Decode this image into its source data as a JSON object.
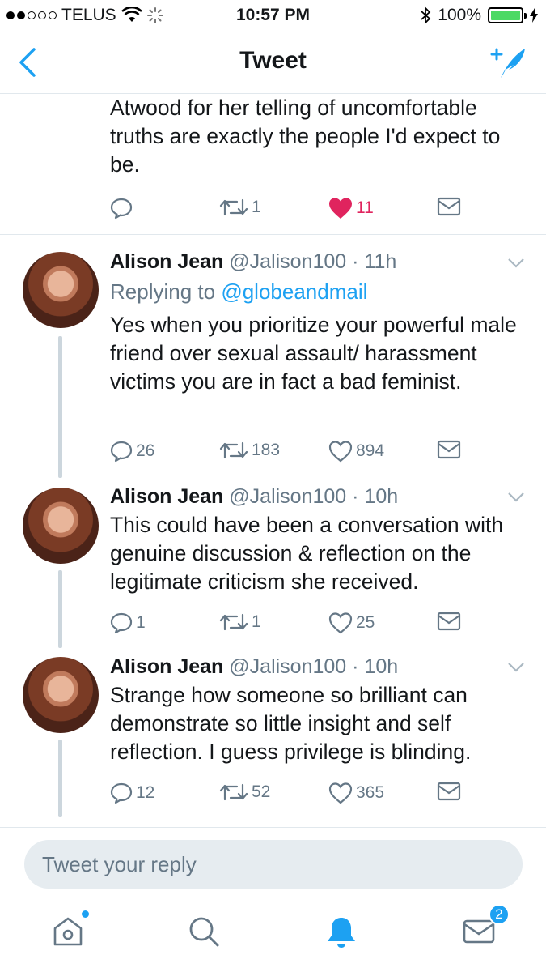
{
  "status_bar": {
    "carrier": "TELUS",
    "time": "10:57 PM",
    "battery": "100%"
  },
  "nav": {
    "title": "Tweet",
    "back_icon": "chevron-left-icon",
    "compose_icon": "compose-tweet-icon"
  },
  "top_tweet": {
    "text": "Atwood for her telling of uncomfortable truths are exactly the people I'd expect to be.",
    "reply_count": "",
    "retweet_count": "1",
    "like_count": "11",
    "liked": true
  },
  "replies": [
    {
      "name": "Alison Jean",
      "handle": "@Jalison100",
      "time": "· 11h",
      "replying_label": "Replying to",
      "replying_to": "@globeandmail",
      "text": "Yes when you prioritize your powerful male friend over sexual assault/ harassment victims you are in fact a bad feminist.",
      "reply_count": "26",
      "retweet_count": "183",
      "like_count": "894"
    },
    {
      "name": "Alison Jean",
      "handle": "@Jalison100",
      "time": "· 10h",
      "text": "This could have been a conversation with genuine discussion & reflection on the legitimate criticism she received.",
      "reply_count": "1",
      "retweet_count": "1",
      "like_count": "25"
    },
    {
      "name": "Alison Jean",
      "handle": "@Jalison100",
      "time": "· 10h",
      "text": "Strange how someone so brilliant can demonstrate so little insight and self reflection. I guess privilege is blinding.",
      "reply_count": "12",
      "retweet_count": "52",
      "like_count": "365"
    }
  ],
  "reply_box": {
    "placeholder": "Tweet your reply"
  },
  "tabbar": {
    "items": [
      "home-icon",
      "search-icon",
      "notifications-icon",
      "messages-icon"
    ],
    "messages_badge": "2",
    "accent": "#1da1f2",
    "like_color": "#e0245e"
  }
}
